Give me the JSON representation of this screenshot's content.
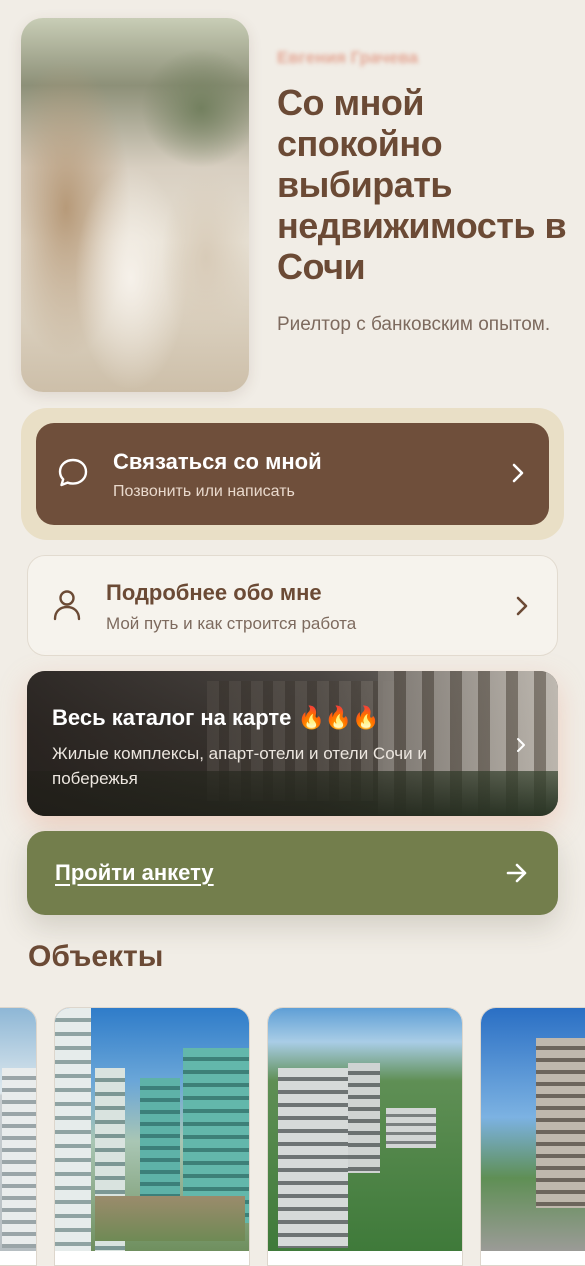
{
  "hero": {
    "name": "Евгения Грачева",
    "title": "Со мной спокойно выбирать недвижимость в Сочи",
    "subtitle": "Риелтор с банковским опытом."
  },
  "contact": {
    "title": "Связаться со мной",
    "subtitle": "Позвонить или написать",
    "icon": "chat-bubble-icon"
  },
  "about": {
    "title": "Подробнее обо мне",
    "subtitle": "Мой путь и как строится работа",
    "icon": "user-icon"
  },
  "catalog": {
    "title": "Весь каталог на карте 🔥🔥🔥",
    "subtitle": "Жилые комплексы, апарт-отели и отели Сочи и побережья"
  },
  "survey": {
    "label": "Пройти анкету",
    "icon": "arrow-right-icon"
  },
  "objects": {
    "title": "Объекты",
    "cards": [
      {
        "name": "object-card-1"
      },
      {
        "name": "object-card-2"
      },
      {
        "name": "object-card-3"
      },
      {
        "name": "object-card-4"
      }
    ]
  },
  "colors": {
    "background": "#f1ede6",
    "brown_primary": "#6f4f3b",
    "contact_halo": "#e9dfc6",
    "olive_button": "#737e4c",
    "name_accent": "#e4a795"
  }
}
